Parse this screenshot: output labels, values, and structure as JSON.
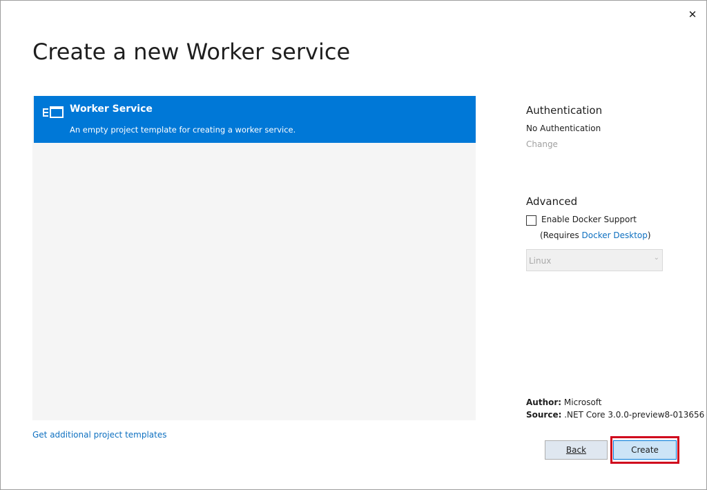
{
  "dialog": {
    "title": "Create a new Worker service",
    "close_glyph": "✕"
  },
  "template": {
    "name": "Worker Service",
    "description": "An empty project template for creating a worker service.",
    "icon": "service-template-icon"
  },
  "more_templates_link": "Get additional project templates",
  "authentication": {
    "title": "Authentication",
    "value": "No Authentication",
    "change_label": "Change"
  },
  "advanced": {
    "title": "Advanced",
    "docker_label": "Enable Docker Support",
    "docker_checked": false,
    "requires_prefix": "(Requires ",
    "requires_link": "Docker Desktop",
    "requires_suffix": ")",
    "os_value": "Linux",
    "os_arrow": "⌄"
  },
  "meta": {
    "author_label": "Author:",
    "author_value": "Microsoft",
    "source_label": "Source:",
    "source_value": ".NET Core 3.0.0-preview8-013656"
  },
  "buttons": {
    "back": "Back",
    "create": "Create"
  },
  "colors": {
    "selection": "#0078d7",
    "link": "#0e70c0",
    "highlight": "#d0021b"
  }
}
